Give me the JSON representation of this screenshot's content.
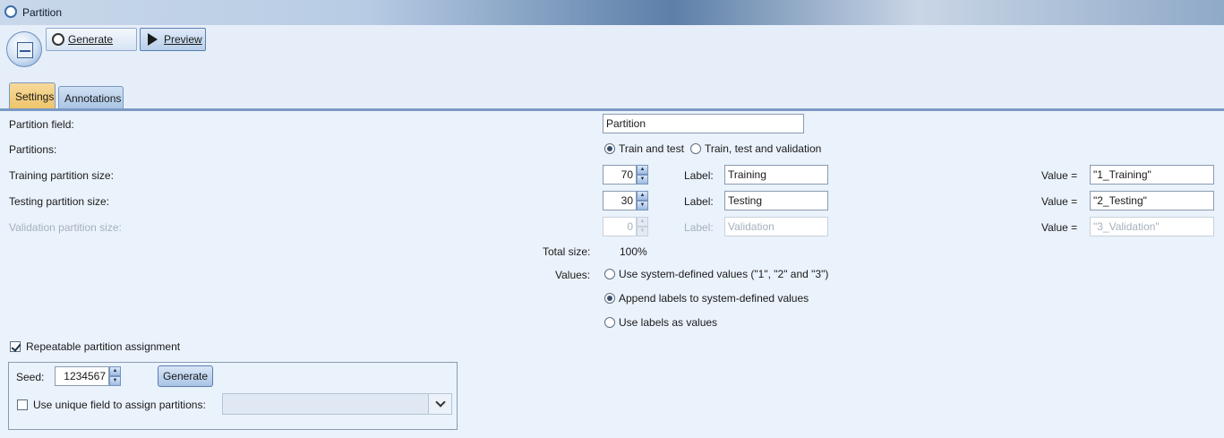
{
  "window": {
    "title": "Partition"
  },
  "toolbar": {
    "generate_label": "Generate",
    "preview_label": "Preview"
  },
  "tabs": [
    {
      "label": "Settings"
    },
    {
      "label": "Annotations"
    }
  ],
  "form": {
    "partition_field": {
      "label": "Partition field:",
      "value": "Partition"
    },
    "partitions": {
      "label": "Partitions:",
      "option_train_test": "Train and test",
      "option_train_test_validation": "Train, test and validation",
      "selected": "Train and test"
    },
    "training": {
      "label": "Training partition size:",
      "size": "70",
      "label_caption": "Label:",
      "label_value": "Training",
      "value_caption": "Value =",
      "value": "\"1_Training\""
    },
    "testing": {
      "label": "Testing partition size:",
      "size": "30",
      "label_caption": "Label:",
      "label_value": "Testing",
      "value_caption": "Value =",
      "value": "\"2_Testing\""
    },
    "validation": {
      "label": "Validation partition size:",
      "size": "0",
      "label_caption": "Label:",
      "label_value": "Validation",
      "value_caption": "Value =",
      "value": "\"3_Validation\""
    },
    "total_size": {
      "label": "Total size:",
      "value": "100%"
    },
    "values": {
      "label": "Values:",
      "options": [
        "Use system-defined values (\"1\", \"2\" and \"3\")",
        "Append labels to system-defined values",
        "Use labels as values"
      ],
      "selected_index": 1
    },
    "repeatable": {
      "label": "Repeatable partition assignment",
      "checked": true
    },
    "seed": {
      "label": "Seed:",
      "value": "1234567",
      "generate_label": "Generate"
    },
    "unique_field": {
      "label": "Use unique field to assign partitions:",
      "checked": false
    }
  }
}
